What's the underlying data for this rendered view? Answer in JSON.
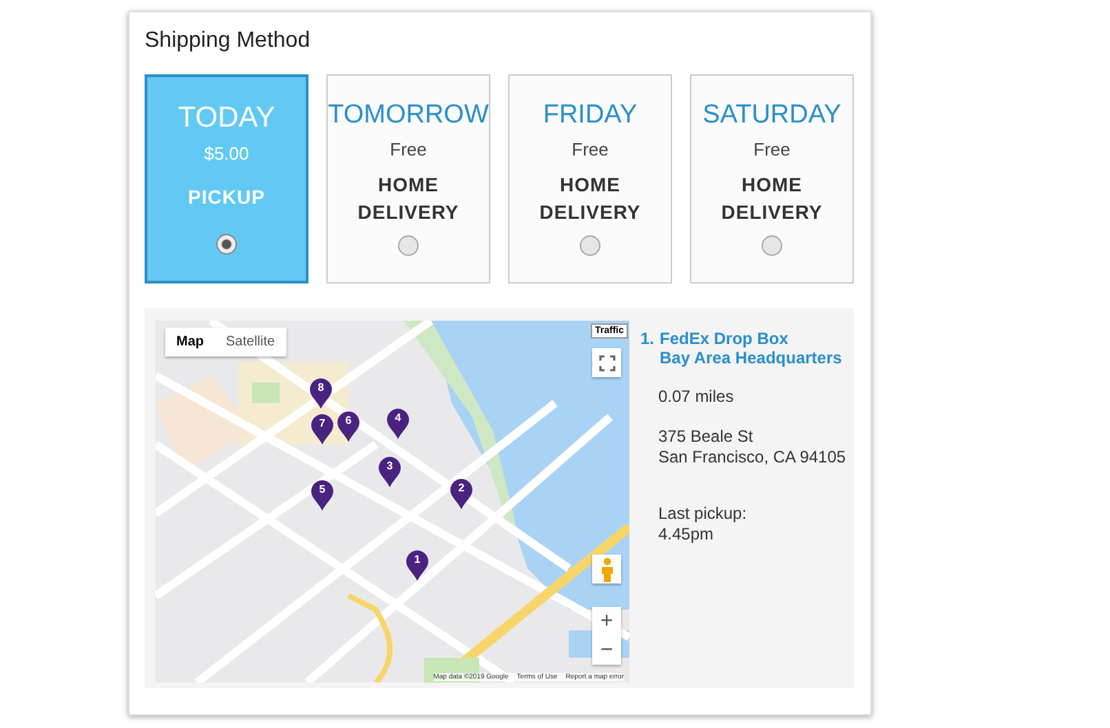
{
  "section_title": "Shipping Method",
  "options": [
    {
      "day": "TODAY",
      "price": "$5.00",
      "method": "PICKUP",
      "selected": true
    },
    {
      "day": "TOMORROW",
      "price": "Free",
      "method": "HOME DELIVERY",
      "selected": false
    },
    {
      "day": "FRIDAY",
      "price": "Free",
      "method": "HOME DELIVERY",
      "selected": false
    },
    {
      "day": "SATURDAY",
      "price": "Free",
      "method": "HOME DELIVERY",
      "selected": false
    }
  ],
  "map": {
    "map_types": [
      {
        "label": "Map",
        "selected": true
      },
      {
        "label": "Satellite",
        "selected": false
      }
    ],
    "traffic_button": "Traffic",
    "zoom_in": "+",
    "zoom_out": "−",
    "pins": [
      "8",
      "7",
      "6",
      "4",
      "3",
      "5",
      "2",
      "1"
    ],
    "attribution": [
      "Map data ©2019 Google",
      "Terms of Use",
      "Report a map error"
    ]
  },
  "location": {
    "number": "1.",
    "name_lines": [
      "FedEx Drop Box",
      "Bay Area Headquarters"
    ],
    "distance": "0.07 miles",
    "address_lines": [
      "375 Beale St",
      "San Francisco, CA 94105"
    ],
    "pickup_lines": [
      "Last pickup:",
      "4.45pm"
    ]
  }
}
